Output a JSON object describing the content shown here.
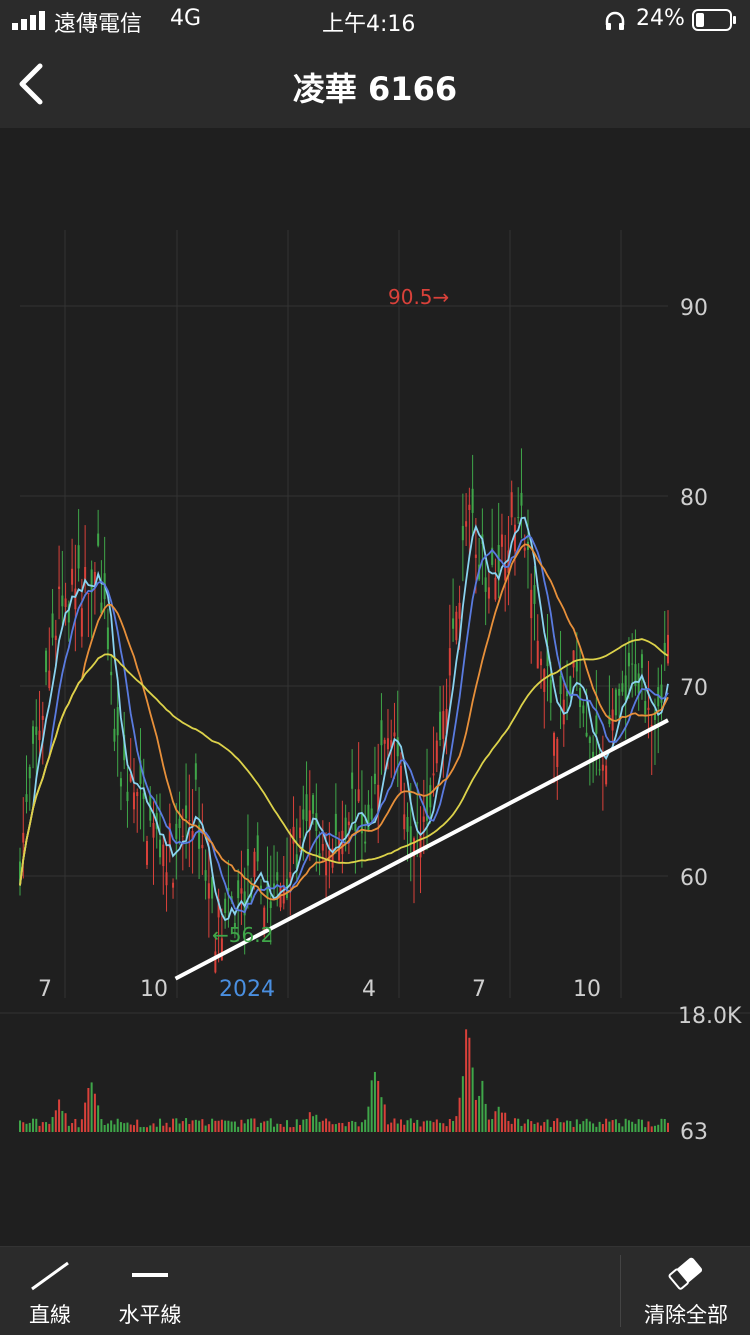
{
  "status": {
    "carrier": "遠傳電信",
    "network": "4G",
    "time": "上午4:16",
    "battery": "24%"
  },
  "header": {
    "title": "凌華 6166"
  },
  "chart_data": {
    "type": "candlestick",
    "price_axis": {
      "ticks": [
        "90",
        "80",
        "70",
        "60"
      ],
      "ylim": [
        54,
        94
      ]
    },
    "x_axis": {
      "ticks": [
        "7",
        "10",
        "2024",
        "4",
        "7",
        "10"
      ]
    },
    "annotations": {
      "high": "90.5",
      "low": "56.2"
    },
    "volume_axis": {
      "max_label": "18.0K",
      "min_label": "63"
    },
    "trendline": {
      "from": [
        0.24,
        54.6
      ],
      "to": [
        1.0,
        68.2
      ]
    },
    "anchors": [
      [
        0,
        61
      ],
      [
        0.03,
        68
      ],
      [
        0.06,
        74
      ],
      [
        0.09,
        75
      ],
      [
        0.12,
        77
      ],
      [
        0.15,
        66
      ],
      [
        0.18,
        64
      ],
      [
        0.21,
        62
      ],
      [
        0.24,
        61
      ],
      [
        0.27,
        64
      ],
      [
        0.3,
        57.5
      ],
      [
        0.33,
        58
      ],
      [
        0.36,
        60
      ],
      [
        0.39,
        58.5
      ],
      [
        0.42,
        61
      ],
      [
        0.45,
        62.5
      ],
      [
        0.48,
        61
      ],
      [
        0.51,
        64
      ],
      [
        0.54,
        62
      ],
      [
        0.57,
        69
      ],
      [
        0.6,
        63
      ],
      [
        0.63,
        64
      ],
      [
        0.66,
        70
      ],
      [
        0.69,
        79
      ],
      [
        0.71,
        76
      ],
      [
        0.74,
        77
      ],
      [
        0.77,
        80
      ],
      [
        0.8,
        72
      ],
      [
        0.83,
        68
      ],
      [
        0.86,
        71
      ],
      [
        0.89,
        66
      ],
      [
        0.92,
        68
      ],
      [
        0.95,
        71
      ],
      [
        0.98,
        69
      ],
      [
        1.0,
        72
      ]
    ],
    "volume_spikes": [
      [
        0.06,
        0.35
      ],
      [
        0.11,
        0.5
      ],
      [
        0.45,
        0.25
      ],
      [
        0.55,
        0.7
      ],
      [
        0.69,
        1.0
      ],
      [
        0.71,
        0.55
      ],
      [
        0.74,
        0.3
      ]
    ]
  },
  "toolbar": {
    "line_label": "直線",
    "hline_label": "水平線",
    "clear_label": "清除全部"
  }
}
